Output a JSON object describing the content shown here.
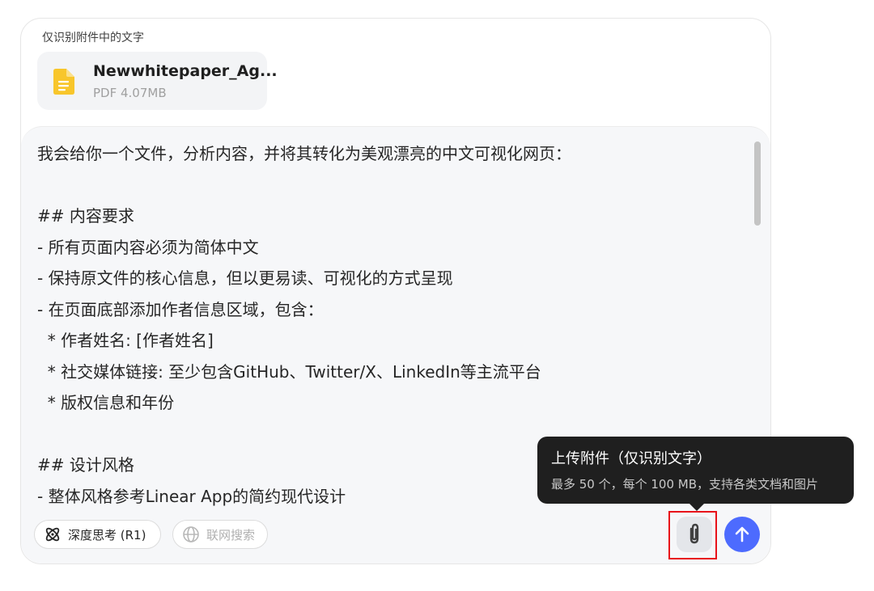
{
  "attachments": {
    "label": "仅识别附件中的文字",
    "file": {
      "name": "Newwhitepaper_Ag...",
      "meta": "PDF 4.07MB",
      "icon": "document-icon"
    }
  },
  "prompt": {
    "lines": [
      "我会给你一个文件，分析内容，并将其转化为美观漂亮的中文可视化网页：",
      "",
      "## 内容要求",
      "- 所有页面内容必须为简体中文",
      "- 保持原文件的核心信息，但以更易读、可视化的方式呈现",
      "- 在页面底部添加作者信息区域，包含：",
      "  * 作者姓名: [作者姓名]",
      "  * 社交媒体链接: 至少包含GitHub、Twitter/X、LinkedIn等主流平台",
      "  * 版权信息和年份",
      "",
      "## 设计风格",
      "- 整体风格参考Linear App的简约现代设计"
    ]
  },
  "toolbar": {
    "deep_think_label": "深度思考 (R1)",
    "web_search_label": "联网搜索",
    "deep_think_icon": "atom-icon",
    "web_search_icon": "globe-icon",
    "attach_icon": "paperclip-icon",
    "send_icon": "arrow-up-icon"
  },
  "tooltip": {
    "title": "上传附件（仅识别文字）",
    "description": "最多 50 个，每个 100 MB，支持各类文档和图片"
  },
  "colors": {
    "accent": "#4d6bfe",
    "file_icon": "#f8c62b",
    "highlight": "#e8121a",
    "tooltip_bg": "#1f1f1f"
  }
}
